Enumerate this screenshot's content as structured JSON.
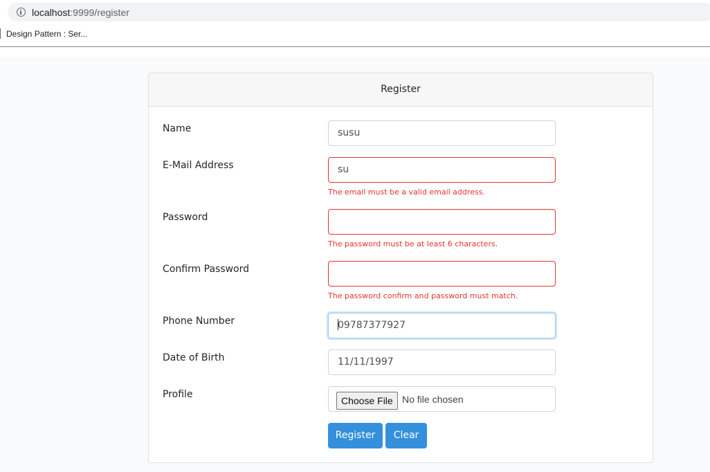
{
  "browser": {
    "url_host": "localhost",
    "url_path": ":9999/register",
    "bookmark": "Design Pattern : Ser..."
  },
  "form": {
    "title": "Register",
    "fields": {
      "name": {
        "label": "Name",
        "value": "susu"
      },
      "email": {
        "label": "E-Mail Address",
        "value": "su",
        "error": "The email must be a valid email address."
      },
      "password": {
        "label": "Password",
        "value": "",
        "error": "The password must be at least 6 characters."
      },
      "confirm": {
        "label": "Confirm Password",
        "value": "",
        "error": "The password confirm and password must match."
      },
      "phone": {
        "label": "Phone Number",
        "value": "09787377927"
      },
      "dob": {
        "label": "Date of Birth",
        "value": "11/11/1997"
      },
      "profile": {
        "label": "Profile",
        "button": "Choose File",
        "status": "No file chosen"
      }
    },
    "buttons": {
      "register": "Register",
      "clear": "Clear"
    }
  },
  "colors": {
    "primary": "#3490dc",
    "danger": "#e3342f",
    "background": "#f8fafc"
  }
}
